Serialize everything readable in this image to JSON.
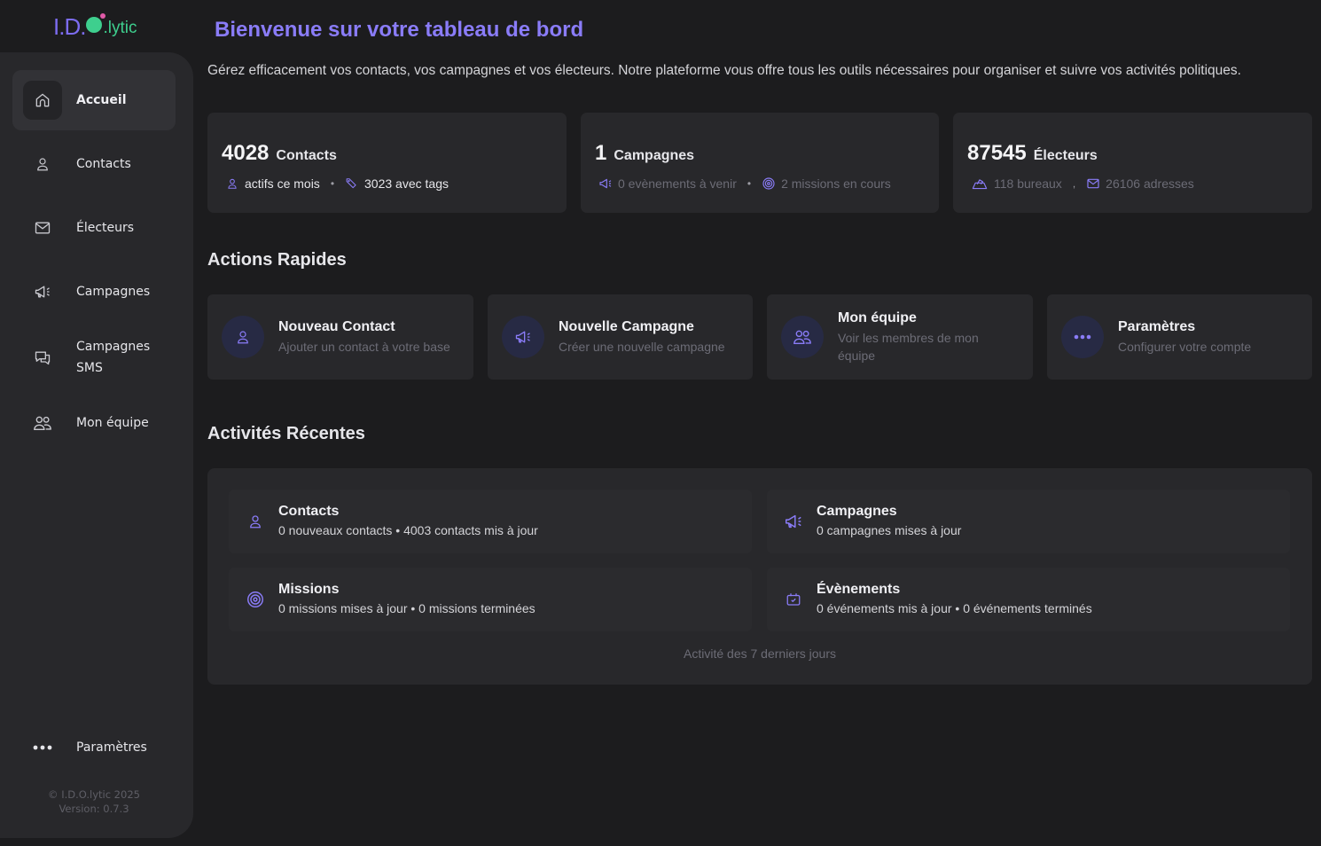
{
  "brand": {
    "logo_left": "I.D.",
    "logo_right": ".lytic"
  },
  "sidebar": {
    "items": [
      {
        "label": "Accueil",
        "icon": "home-icon",
        "active": true
      },
      {
        "label": "Contacts",
        "icon": "user-icon"
      },
      {
        "label": "Électeurs",
        "icon": "mail-icon"
      },
      {
        "label": "Campagnes",
        "icon": "megaphone-icon"
      },
      {
        "label": "Campagnes SMS",
        "icon": "chat-icon"
      },
      {
        "label": "Mon équipe",
        "icon": "team-icon"
      }
    ],
    "settings_label": "Paramètres",
    "footer_copyright": "© I.D.O.lytic 2025",
    "footer_version": "Version: 0.7.3"
  },
  "header": {
    "title": "Bienvenue sur votre tableau de bord",
    "description": "Gérez efficacement vos contacts, vos campagnes et vos électeurs. Notre plateforme vous offre tous les outils nécessaires pour organiser et suivre vos activités politiques."
  },
  "stats": [
    {
      "value": "4028",
      "unit": "Contacts",
      "sub1": "actifs ce mois",
      "sub2": "3023 avec tags"
    },
    {
      "value": "1",
      "unit": "Campagnes",
      "sub1": "0 evènements à venir",
      "sub2": "2 missions en cours"
    },
    {
      "value": "87545",
      "unit": "Électeurs",
      "sub1": "118 bureaux",
      "sub2": "26106 adresses"
    }
  ],
  "quick_actions": {
    "title": "Actions Rapides",
    "items": [
      {
        "title": "Nouveau Contact",
        "subtitle": "Ajouter un contact à votre base"
      },
      {
        "title": "Nouvelle Campagne",
        "subtitle": "Créer une nouvelle campagne"
      },
      {
        "title": "Mon équipe",
        "subtitle": "Voir les membres de mon équipe"
      },
      {
        "title": "Paramètres",
        "subtitle": "Configurer votre compte"
      }
    ]
  },
  "recent": {
    "title": "Activités Récentes",
    "items": [
      {
        "title": "Contacts",
        "detail": "0 nouveaux contacts • 4003 contacts mis à jour"
      },
      {
        "title": "Campagnes",
        "detail": "0 campagnes mises à jour"
      },
      {
        "title": "Missions",
        "detail": "0 missions mises à jour • 0 missions terminées"
      },
      {
        "title": "Évènements",
        "detail": "0 événements mis à jour • 0 événements terminés"
      }
    ],
    "footer": "Activité des 7 derniers jours"
  },
  "colors": {
    "accent": "#8a7cf8",
    "background": "#1c1c1e",
    "card": "#28282b",
    "logo_green": "#3ecf8e"
  }
}
